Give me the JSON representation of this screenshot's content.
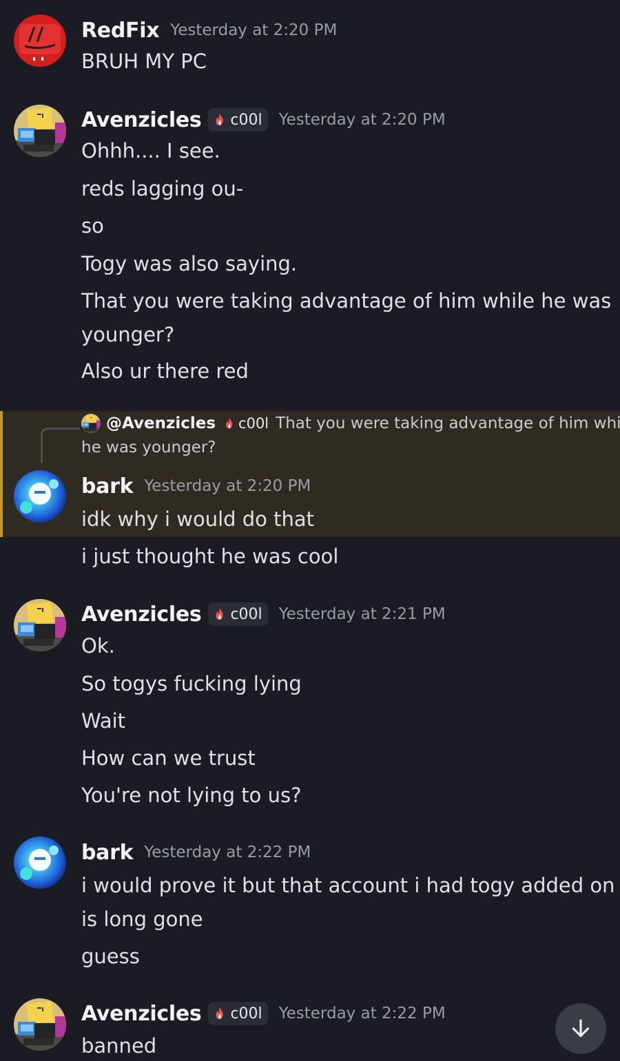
{
  "colors": {
    "background": "#1a1b23",
    "highlight_background": "#2f2a22",
    "highlight_border": "#c59a2b",
    "username": "#f2f3f5",
    "timestamp": "#9a9ca5",
    "message_text": "#dfe1e5"
  },
  "tag": {
    "icon": "fire-icon",
    "label": "c00l"
  },
  "messages": [
    {
      "author": "RedFix",
      "avatar": "redfix-avatar",
      "time": "Yesterday at 2:20 PM",
      "lines": [
        "BRUH MY PC"
      ]
    },
    {
      "author": "Avenzicles",
      "avatar": "avenzicles-avatar",
      "tag": "c00l",
      "time": "Yesterday at 2:20 PM",
      "lines": [
        "Ohhh.... I see.",
        "reds lagging ou-",
        "so",
        "Togy was also saying.",
        "That you were taking advantage of him while he was",
        "younger?",
        "Also ur there red"
      ]
    },
    {
      "author": "bark",
      "avatar": "bark-avatar",
      "time": "Yesterday at 2:20 PM",
      "reply": {
        "mention": "@Avenzicles",
        "tag": "c00l",
        "text_line1": "That you were taking advantage of him while",
        "text_line2": "he was younger?"
      },
      "lines": [
        "idk why i would do that",
        "i just thought he was cool"
      ]
    },
    {
      "author": "Avenzicles",
      "avatar": "avenzicles-avatar",
      "tag": "c00l",
      "time": "Yesterday at 2:21 PM",
      "lines": [
        "Ok.",
        "So togys fucking lying",
        "Wait",
        "How can we trust",
        "You're not lying to us?"
      ]
    },
    {
      "author": "bark",
      "avatar": "bark-avatar",
      "time": "Yesterday at 2:22 PM",
      "lines": [
        "i would prove it but that account i had togy added on",
        "is long gone",
        "guess"
      ]
    },
    {
      "author": "Avenzicles",
      "avatar": "avenzicles-avatar",
      "tag": "c00l",
      "time": "Yesterday at 2:22 PM",
      "lines": [
        "banned"
      ]
    }
  ],
  "jump_button": {
    "icon": "arrow-down-icon"
  }
}
